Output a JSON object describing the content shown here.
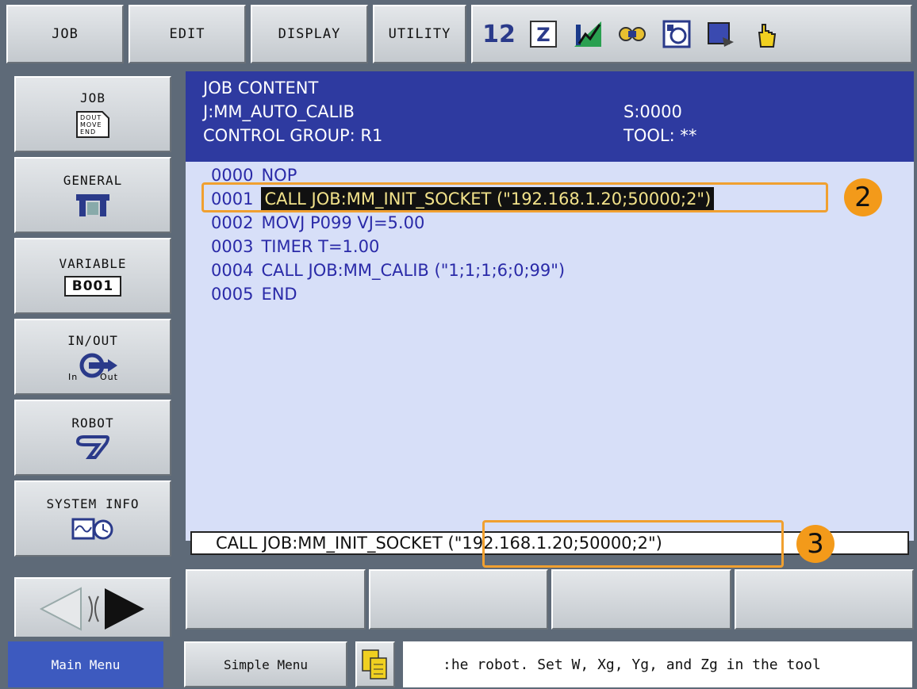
{
  "top_menu": [
    "JOB",
    "EDIT",
    "DISPLAY",
    "UTILITY"
  ],
  "status_icons": [
    "mode-12-icon",
    "edit-mode-icon",
    "signal-icon",
    "key-icon",
    "teach-icon",
    "step-icon",
    "hand-icon"
  ],
  "status_texts": {
    "mode": "12",
    "edit": "Z"
  },
  "side_menu": [
    {
      "label": "JOB",
      "icon": "job-doc-icon",
      "icon_text": "DOUT\nMOVE\nEND"
    },
    {
      "label": "GENERAL",
      "icon": "general-tool-icon"
    },
    {
      "label": "VARIABLE",
      "icon": "variable-icon",
      "icon_text": "B001"
    },
    {
      "label": "IN/OUT",
      "icon": "in-out-icon",
      "icon_text_in": "In",
      "icon_text_out": "Out"
    },
    {
      "label": "ROBOT",
      "icon": "robot-arm-icon"
    },
    {
      "label": "SYSTEM INFO",
      "icon": "system-info-icon"
    }
  ],
  "job_header": {
    "title": "JOB CONTENT",
    "job_name": "J:MM_AUTO_CALIB",
    "step": "S:0000",
    "control_group": "CONTROL GROUP: R1",
    "tool": "TOOL: **"
  },
  "code_lines": [
    {
      "num": "0000",
      "stmt": "NOP"
    },
    {
      "num": "0001",
      "stmt": "CALL JOB:MM_INIT_SOCKET (\"192.168.1.20;50000;2\")",
      "highlight": true
    },
    {
      "num": "0002",
      "stmt": "MOVJ P099 VJ=5.00"
    },
    {
      "num": "0003",
      "stmt": "TIMER T=1.00"
    },
    {
      "num": "0004",
      "stmt": "CALL JOB:MM_CALIB (\"1;1;1;6;0;99\")"
    },
    {
      "num": "0005",
      "stmt": "END"
    }
  ],
  "annotations": {
    "two": "2",
    "three": "3"
  },
  "edit_line": "CALL JOB:MM_INIT_SOCKET (\"192.168.1.20;50000;2\")",
  "bottom": {
    "main_menu": "Main Menu",
    "simple_menu": "Simple Menu",
    "message": ":he robot. Set W, Xg, Yg, and Zg in the tool"
  },
  "colors": {
    "header_bg": "#2e3aa0",
    "code_bg": "#d7dff8",
    "highlight": "#f2e28a",
    "annotation": "#f39a1a",
    "main_menu_bg": "#3d5abf"
  }
}
